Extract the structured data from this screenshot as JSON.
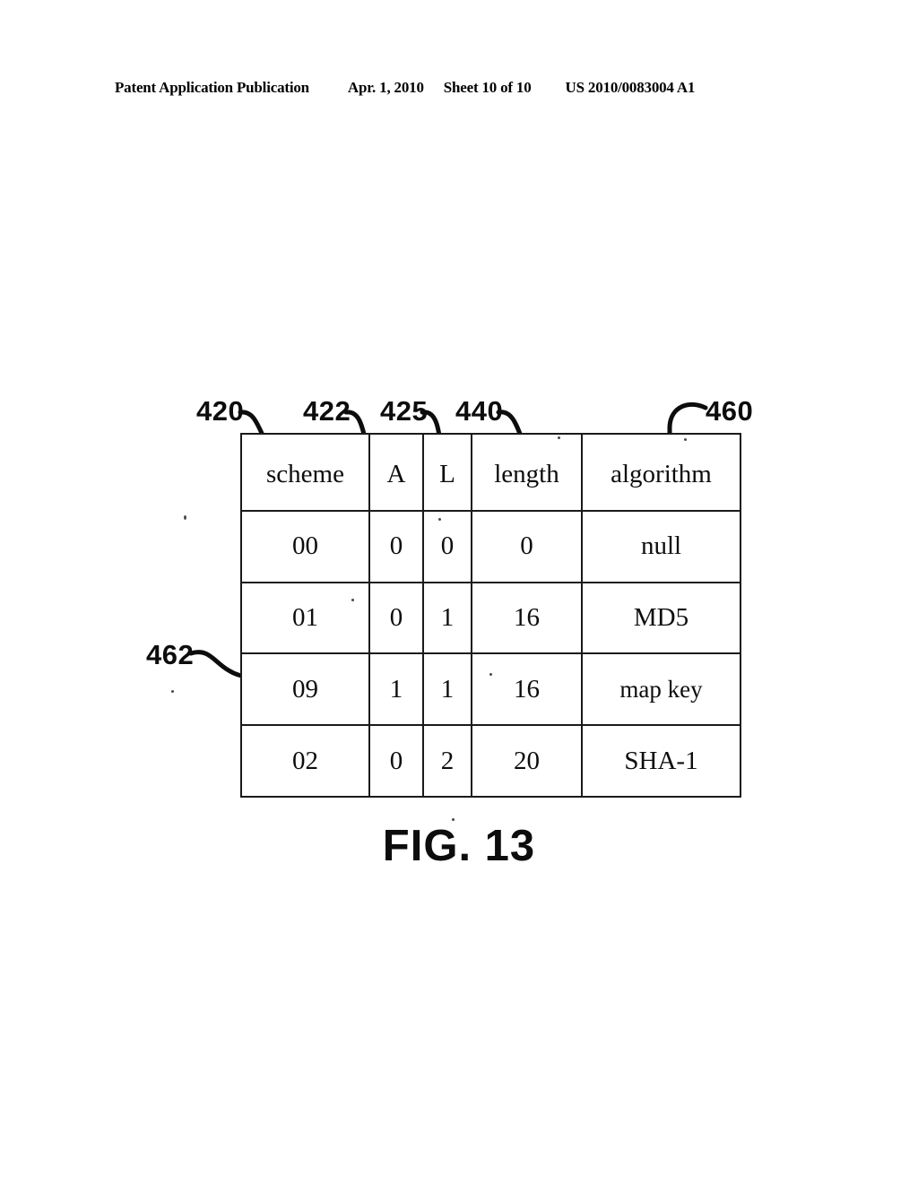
{
  "page_header": {
    "publication_label": "Patent Application Publication",
    "date": "Apr. 1, 2010",
    "sheet": "Sheet 10 of 10",
    "publication_number": "US 2010/0083004 A1"
  },
  "figure": {
    "caption": "FIG. 13",
    "table": {
      "columns": [
        "scheme",
        "A",
        "L",
        "length",
        "algorithm"
      ],
      "rows": [
        [
          "00",
          "0",
          "0",
          "0",
          "null"
        ],
        [
          "01",
          "0",
          "1",
          "16",
          "MD5"
        ],
        [
          "09",
          "1",
          "1",
          "16",
          "map key"
        ],
        [
          "02",
          "0",
          "2",
          "20",
          "SHA-1"
        ]
      ]
    },
    "reference_numerals": [
      {
        "id": "420",
        "label": "420",
        "target": "scheme-column"
      },
      {
        "id": "422",
        "label": "422",
        "target": "a-column"
      },
      {
        "id": "425",
        "label": "425",
        "target": "l-column"
      },
      {
        "id": "440",
        "label": "440",
        "target": "length-column"
      },
      {
        "id": "460",
        "label": "460",
        "target": "algorithm-column"
      },
      {
        "id": "462",
        "label": "462",
        "target": "map-key-row"
      }
    ]
  },
  "colors": {
    "ink": "#0d0d0d",
    "rule": "#1a1a1a",
    "paper": "#ffffff"
  }
}
